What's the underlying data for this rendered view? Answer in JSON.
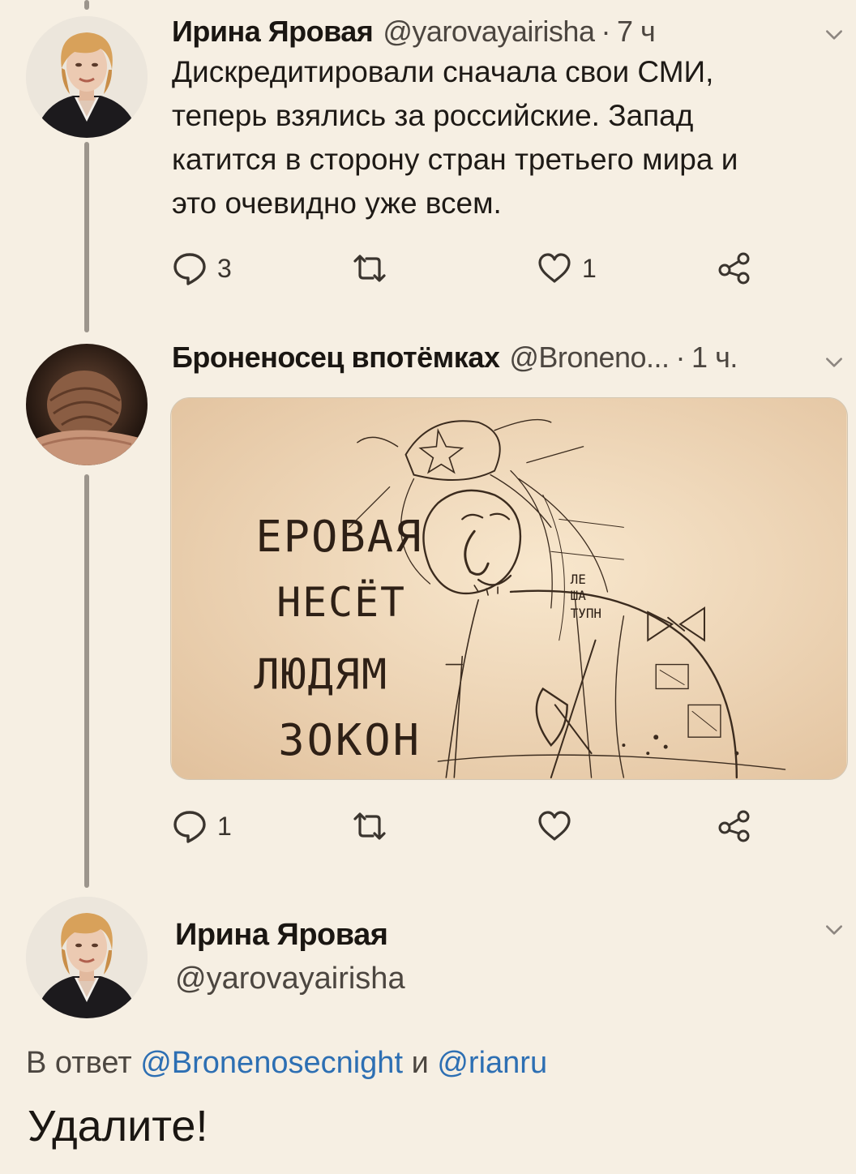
{
  "tweet1": {
    "name": "Ирина Яровая",
    "handle": "@yarovayairisha",
    "time": "7 ч",
    "lines": [
      "Дискредитировали сначала свои СМИ,",
      "теперь взялись за российские. Запад",
      "катится в сторону стран третьего  мира и",
      "это очевидно уже всем."
    ],
    "reply_count": "3",
    "retweet_count": "",
    "like_count": "1"
  },
  "tweet2": {
    "name": "Броненосец впотёмках",
    "handle": "@Broneno...",
    "time": "1 ч.",
    "reply_count": "1",
    "retweet_count": "",
    "like_count": "",
    "image_text": [
      "ЕРОВАЯ",
      "НЕСЁТ",
      "ЛЮДЯМ",
      "ЗОКОН"
    ],
    "image_text_small": [
      "ЛЕ",
      "ША",
      "ТУПН"
    ]
  },
  "tweet3": {
    "name": "Ирина Яровая",
    "handle": "@yarovayairisha",
    "reply_prefix": "В ответ",
    "mention1": "@Bronenosecnight",
    "conj": "и",
    "mention2": "@rianru",
    "text": "Удалите!"
  },
  "separator": "·",
  "icons": {
    "reply": "reply-icon",
    "retweet": "retweet-icon",
    "like": "like-icon",
    "share": "share-icon",
    "menu": "chevron-down-icon"
  },
  "colors": {
    "background": "#f6efe3",
    "mention": "#2d6fb3",
    "thread_line": "#9c958c"
  }
}
